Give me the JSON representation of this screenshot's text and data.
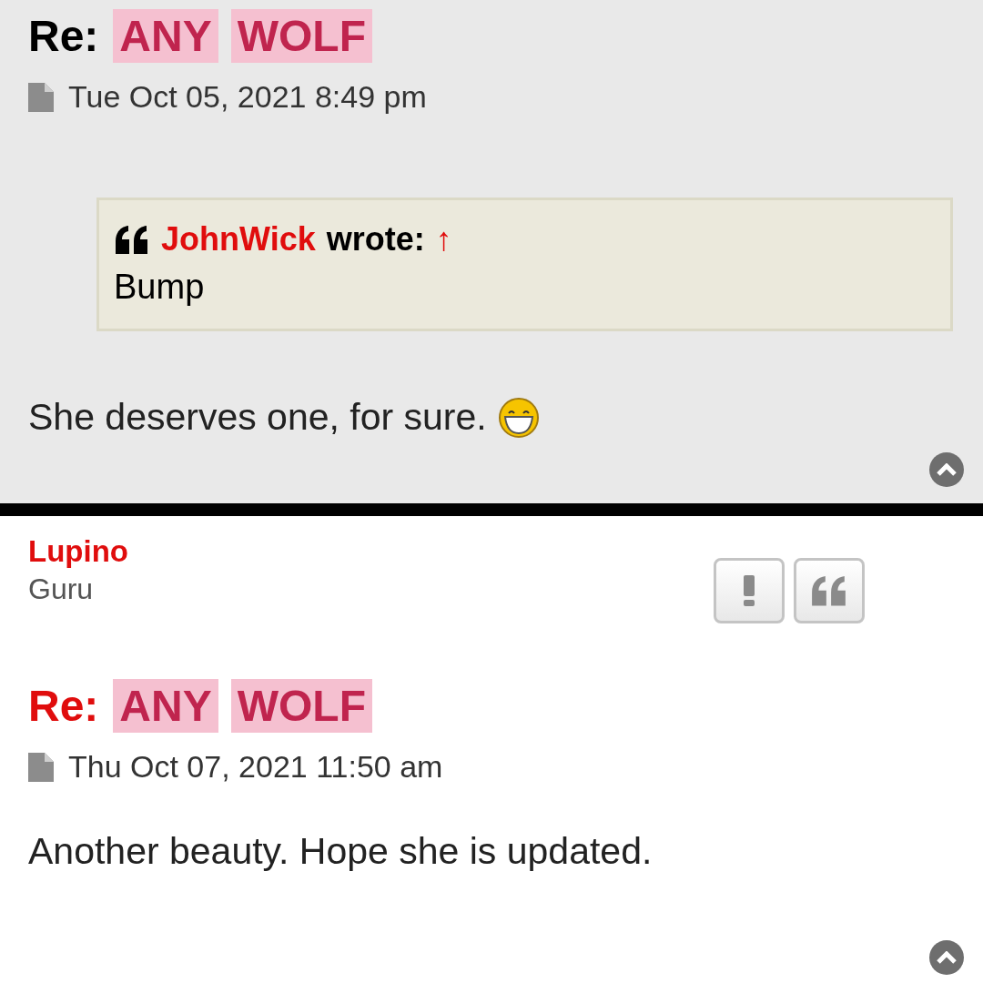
{
  "posts": [
    {
      "shaded": true,
      "title": {
        "prefix": "Re:",
        "unread": false,
        "highlights": [
          "ANY",
          "WOLF"
        ]
      },
      "date": "Tue Oct 05, 2021 8:49 pm",
      "quote": {
        "author": "JohnWick",
        "wrote": "wrote:",
        "arrow": "↑",
        "text": "Bump"
      },
      "body": "She deserves one, for sure.",
      "smiley": true
    },
    {
      "shaded": false,
      "author": {
        "name": "Lupino",
        "rank": "Guru",
        "buttons": [
          {
            "kind": "report"
          },
          {
            "kind": "quote"
          }
        ]
      },
      "title": {
        "prefix": "Re:",
        "unread": true,
        "highlights": [
          "ANY",
          "WOLF"
        ]
      },
      "date": "Thu Oct 07, 2021 11:50 am",
      "body": "Another beauty. Hope she is updated.",
      "smiley": false
    }
  ]
}
